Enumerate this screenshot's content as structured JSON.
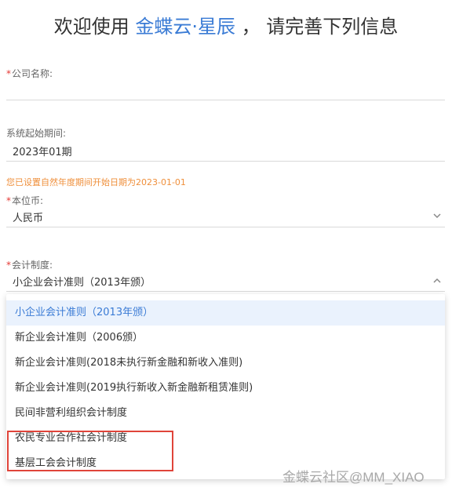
{
  "header": {
    "prefix": "欢迎使用",
    "brand": "金蝶云·星辰",
    "suffix": "，  请完善下列信息"
  },
  "form": {
    "company": {
      "required_mark": "*",
      "label": "公司名称:",
      "value": ""
    },
    "period": {
      "label": "系统起始期间:",
      "value": "2023年01期"
    },
    "hint": "您已设置自然年度期间开始日期为2023-01-01",
    "currency": {
      "required_mark": "*",
      "label": "本位币:",
      "value": "人民币",
      "icon": "chevron-down-icon"
    },
    "accounting": {
      "required_mark": "*",
      "label": "会计制度:",
      "value": "小企业会计准则（2013年颁）",
      "icon": "chevron-up-icon"
    }
  },
  "dropdown": {
    "options": [
      "小企业会计准则（2013年颁）",
      "新企业会计准则（2006颁）",
      "新企业会计准则(2018未执行新金融和新收入准则)",
      "新企业会计准则(2019执行新收入新金融新租赁准则)",
      "民间非营利组织会计制度",
      "农民专业合作社会计制度",
      "基层工会会计制度"
    ],
    "selected_index": 0
  },
  "colors": {
    "brand": "#3a7bd5",
    "required": "#e53935",
    "hint": "#ef8f3b",
    "highlight_box": "#e0443a",
    "selected_bg": "#eaf2fd"
  },
  "watermark": "金蝶云社区@MM_XIAO"
}
